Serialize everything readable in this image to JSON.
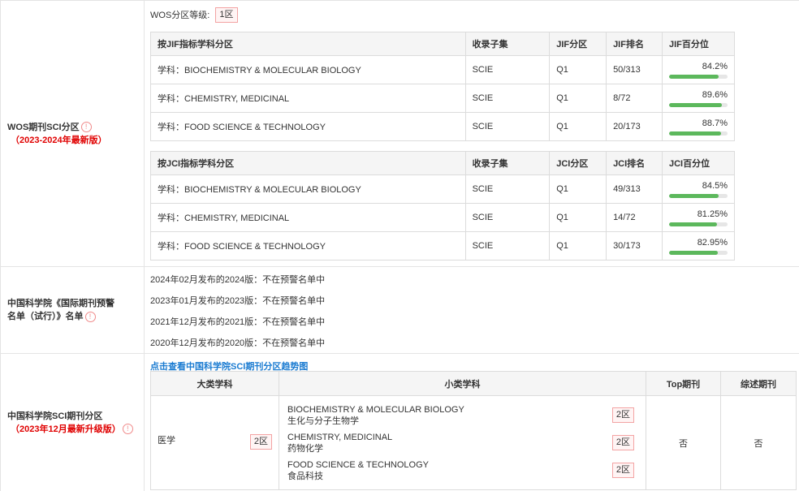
{
  "wos": {
    "label": "WOS期刊SCI分区",
    "label_red": "（2023-2024年最新版）",
    "level_label": "WOS分区等级:",
    "level_value": "1区",
    "jif_headers": [
      "按JIF指标学科分区",
      "收录子集",
      "JIF分区",
      "JIF排名",
      "JIF百分位"
    ],
    "jif_rows": [
      {
        "subject": "学科：BIOCHEMISTRY & MOLECULAR BIOLOGY",
        "set": "SCIE",
        "quartile": "Q1",
        "rank": "50/313",
        "pct": "84.2%",
        "pct_value": 84.2
      },
      {
        "subject": "学科：CHEMISTRY, MEDICINAL",
        "set": "SCIE",
        "quartile": "Q1",
        "rank": "8/72",
        "pct": "89.6%",
        "pct_value": 89.6
      },
      {
        "subject": "学科：FOOD SCIENCE & TECHNOLOGY",
        "set": "SCIE",
        "quartile": "Q1",
        "rank": "20/173",
        "pct": "88.7%",
        "pct_value": 88.7
      }
    ],
    "jci_headers": [
      "按JCI指标学科分区",
      "收录子集",
      "JCI分区",
      "JCI排名",
      "JCI百分位"
    ],
    "jci_rows": [
      {
        "subject": "学科：BIOCHEMISTRY & MOLECULAR BIOLOGY",
        "set": "SCIE",
        "quartile": "Q1",
        "rank": "49/313",
        "pct": "84.5%",
        "pct_value": 84.5
      },
      {
        "subject": "学科：CHEMISTRY, MEDICINAL",
        "set": "SCIE",
        "quartile": "Q1",
        "rank": "14/72",
        "pct": "81.25%",
        "pct_value": 81.25
      },
      {
        "subject": "学科：FOOD SCIENCE & TECHNOLOGY",
        "set": "SCIE",
        "quartile": "Q1",
        "rank": "30/173",
        "pct": "82.95%",
        "pct_value": 82.95
      }
    ]
  },
  "warning": {
    "label_line1": "中国科学院《国际期刊预警",
    "label_line2": "名单（试行）》名单",
    "items": [
      "2024年02月发布的2024版：不在预警名单中",
      "2023年01月发布的2023版：不在预警名单中",
      "2021年12月发布的2021版：不在预警名单中",
      "2020年12月发布的2020版：不在预警名单中"
    ]
  },
  "cas": {
    "label": "中国科学院SCI期刊分区",
    "label_red": "（2023年12月最新升级版）",
    "link": "点击查看中国科学院SCI期刊分区趋势图",
    "headers": [
      "大类学科",
      "小类学科",
      "Top期刊",
      "综述期刊"
    ],
    "major": "医学",
    "major_zone": "2区",
    "subs": [
      {
        "en": "BIOCHEMISTRY & MOLECULAR BIOLOGY",
        "zh": "生化与分子生物学",
        "zone": "2区"
      },
      {
        "en": "CHEMISTRY, MEDICINAL",
        "zh": "药物化学",
        "zone": "2区"
      },
      {
        "en": "FOOD SCIENCE & TECHNOLOGY",
        "zh": "食品科技",
        "zone": "2区"
      }
    ],
    "top": "否",
    "review": "否"
  },
  "info_icon_glyph": "!"
}
